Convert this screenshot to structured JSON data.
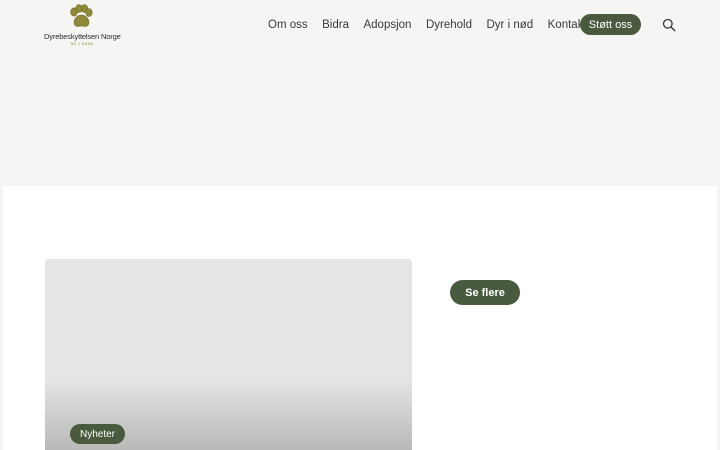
{
  "logo": {
    "name": "Dyrebeskyttelsen Norge",
    "tagline": "NO 1 EANA"
  },
  "nav": {
    "items": [
      {
        "label": "Om oss"
      },
      {
        "label": "Bidra"
      },
      {
        "label": "Adopsjon"
      },
      {
        "label": "Dyrehold"
      },
      {
        "label": "Dyr i nød"
      },
      {
        "label": "Kontakt"
      }
    ],
    "cta_label": "Støtt oss"
  },
  "news": {
    "card_tag": "Nyheter",
    "more_label": "Se flere"
  },
  "colors": {
    "brand_green": "#4a5a3e",
    "logo_gold": "#8a8a2e",
    "page_bg": "#f6f5f3"
  },
  "icons": [
    "paw-icon",
    "search-icon"
  ]
}
